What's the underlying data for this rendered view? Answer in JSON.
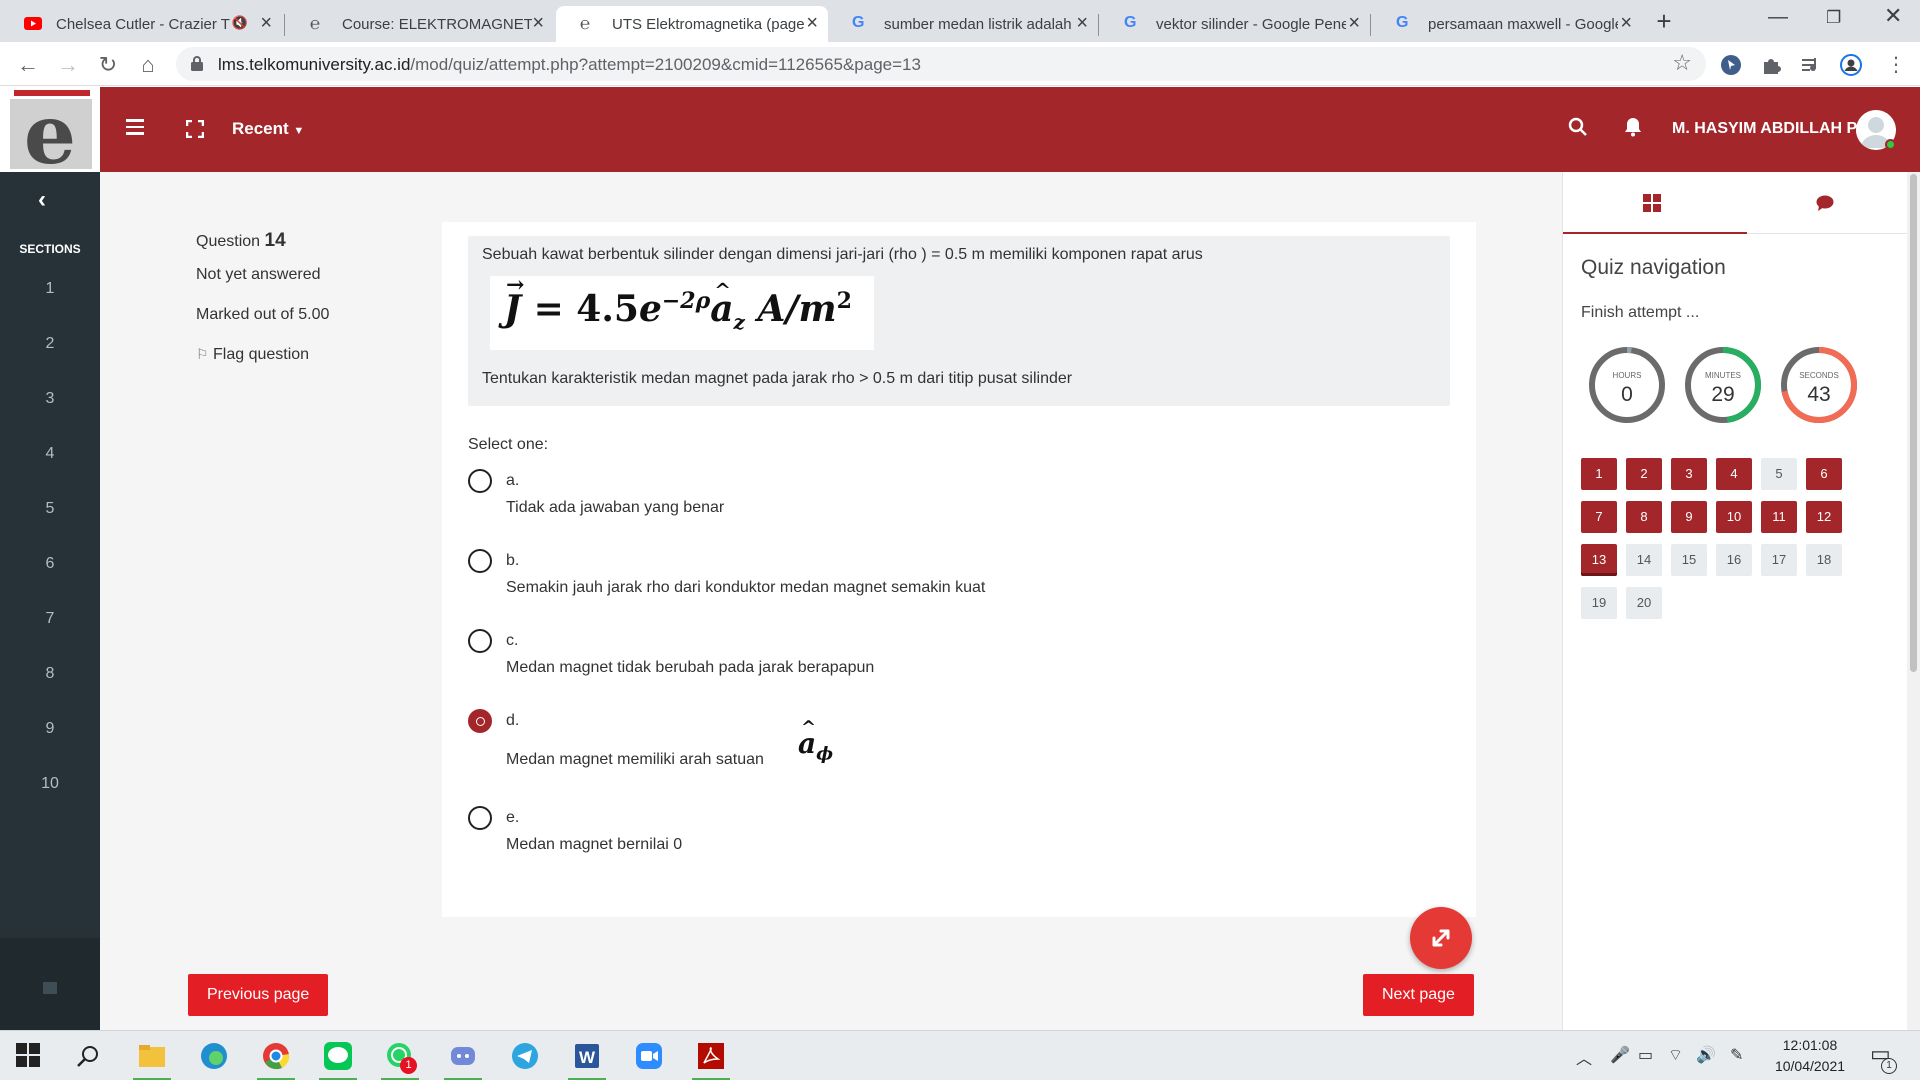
{
  "browser": {
    "tabs": [
      {
        "title": "Chelsea Cutler - Crazier T",
        "icon": "youtube-icon"
      },
      {
        "title": "Course: ELEKTROMAGNETIKA",
        "icon": "telkom-e-icon"
      },
      {
        "title": "UTS Elektromagnetika (page",
        "icon": "telkom-e-icon"
      },
      {
        "title": "sumber medan listrik adalah",
        "icon": "google-icon"
      },
      {
        "title": "vektor silinder - Google Pene",
        "icon": "google-icon"
      },
      {
        "title": "persamaan maxwell - Google",
        "icon": "google-icon"
      }
    ],
    "url_host": "lms.telkomuniversity.ac.id",
    "url_path": "/mod/quiz/attempt.php?attempt=2100209&cmid=1126565&page=13"
  },
  "header": {
    "recent_label": "Recent",
    "user_name": "M. HASYIM ABDILLAH P.",
    "brand_color": "#a3262b"
  },
  "sidebar": {
    "title": "SECTIONS",
    "sections": [
      "1",
      "2",
      "3",
      "4",
      "5",
      "6",
      "7",
      "8",
      "9",
      "10"
    ]
  },
  "question": {
    "label": "Question",
    "number": "14",
    "status": "Not yet answered",
    "marks": "Marked out of 5.00",
    "flag_label": "Flag question",
    "text_intro": "Sebuah kawat berbentuk silinder dengan dimensi jari-jari (rho ) = 0.5 m memiliki komponen rapat arus",
    "formula": {
      "lhs": "J",
      "coef": "4.5",
      "base": "e",
      "exponent": "−2ρ",
      "unit_vector": "a",
      "unit_sub": "z",
      "unit": "A/m",
      "unit_exp": "2"
    },
    "text_task": "Tentukan karakteristik medan magnet pada jarak  rho > 0.5 m dari titip pusat silinder",
    "select_label": "Select one:",
    "options": [
      {
        "letter": "a.",
        "text": "Tidak ada jawaban yang benar",
        "checked": false
      },
      {
        "letter": "b.",
        "text": "Semakin jauh jarak  rho dari konduktor medan magnet semakin kuat",
        "checked": false
      },
      {
        "letter": "c.",
        "text": "Medan magnet tidak berubah pada jarak berapapun",
        "checked": false
      },
      {
        "letter": "d.",
        "text": "Medan magnet memiliki arah satuan",
        "checked": true,
        "symbol": "a",
        "symbol_sub": "ϕ"
      },
      {
        "letter": "e.",
        "text": "Medan magnet bernilai 0",
        "checked": false
      }
    ],
    "prev_label": "Previous page",
    "next_label": "Next page"
  },
  "quiz_nav": {
    "title": "Quiz navigation",
    "finish_label": "Finish attempt ...",
    "timer": [
      {
        "label": "HOURS",
        "value": "0",
        "fraction": 0.02,
        "color": "#90a4ae"
      },
      {
        "label": "MINUTES",
        "value": "29",
        "fraction": 0.48,
        "color": "#27ae60"
      },
      {
        "label": "SECONDS",
        "value": "43",
        "fraction": 0.72,
        "color": "#f26b55"
      }
    ],
    "questions": [
      {
        "n": "1",
        "state": "done"
      },
      {
        "n": "2",
        "state": "done"
      },
      {
        "n": "3",
        "state": "done"
      },
      {
        "n": "4",
        "state": "done"
      },
      {
        "n": "5",
        "state": "todo"
      },
      {
        "n": "6",
        "state": "done"
      },
      {
        "n": "7",
        "state": "done"
      },
      {
        "n": "8",
        "state": "done"
      },
      {
        "n": "9",
        "state": "done"
      },
      {
        "n": "10",
        "state": "done"
      },
      {
        "n": "11",
        "state": "done"
      },
      {
        "n": "12",
        "state": "done"
      },
      {
        "n": "13",
        "state": "current"
      },
      {
        "n": "14",
        "state": "todo"
      },
      {
        "n": "15",
        "state": "todo"
      },
      {
        "n": "16",
        "state": "todo"
      },
      {
        "n": "17",
        "state": "todo"
      },
      {
        "n": "18",
        "state": "todo"
      },
      {
        "n": "19",
        "state": "todo"
      },
      {
        "n": "20",
        "state": "todo"
      }
    ]
  },
  "taskbar": {
    "time": "12:01:08",
    "date": "10/04/2021",
    "whatsapp_badge": "1",
    "notification_badge": "1"
  }
}
